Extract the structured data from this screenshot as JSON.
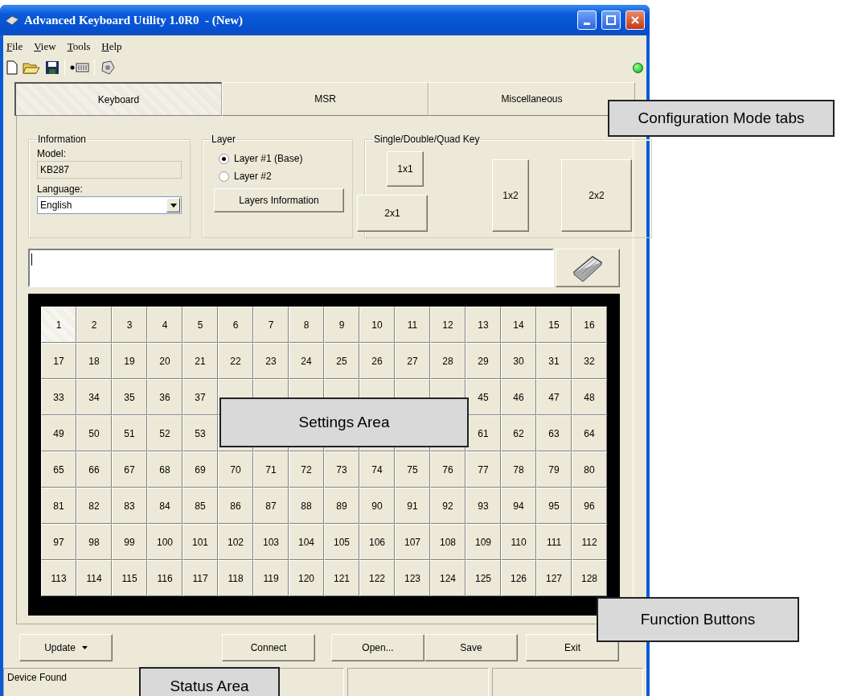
{
  "window": {
    "title": "Advanced Keyboard Utility 1.0R0  - (New)"
  },
  "menu": [
    {
      "label": "File"
    },
    {
      "label": "View"
    },
    {
      "label": "Tools"
    },
    {
      "label": "Help"
    }
  ],
  "device_indicator": {
    "on": true
  },
  "tabs": [
    {
      "label": "Keyboard",
      "selected": true
    },
    {
      "label": "MSR",
      "selected": false
    },
    {
      "label": "Miscellaneous",
      "selected": false
    }
  ],
  "information": {
    "title": "Information",
    "model_label": "Model:",
    "model_value": "KB287",
    "language_label": "Language:",
    "language_value": "English"
  },
  "layer": {
    "title": "Layer",
    "options": [
      {
        "label": "Layer #1 (Base)",
        "selected": true
      },
      {
        "label": "Layer #2",
        "selected": false
      }
    ],
    "button": "Layers Information"
  },
  "key_size": {
    "title": "Single/Double/Quad Key",
    "buttons": [
      {
        "label": "1x1",
        "kind": "single"
      },
      {
        "label": "2x1",
        "kind": "wide"
      },
      {
        "label": "1x2",
        "kind": "tall"
      },
      {
        "label": "2x2",
        "kind": "quad"
      }
    ]
  },
  "key_grid": {
    "rows": [
      [
        {
          "label": "1",
          "selected": true
        },
        {
          "label": "2",
          "selected": false
        },
        {
          "label": "3",
          "selected": false
        },
        {
          "label": "4",
          "selected": false
        },
        {
          "label": "5",
          "selected": false
        },
        {
          "label": "6",
          "selected": false
        },
        {
          "label": "7",
          "selected": false
        },
        {
          "label": "8",
          "selected": false
        },
        {
          "label": "9",
          "selected": false
        },
        {
          "label": "10",
          "selected": false
        },
        {
          "label": "11",
          "selected": false
        },
        {
          "label": "12",
          "selected": false
        },
        {
          "label": "13",
          "selected": false
        },
        {
          "label": "14",
          "selected": false
        },
        {
          "label": "15",
          "selected": false
        },
        {
          "label": "16",
          "selected": false
        }
      ],
      [
        {
          "label": "17",
          "selected": false
        },
        {
          "label": "18",
          "selected": false
        },
        {
          "label": "19",
          "selected": false
        },
        {
          "label": "20",
          "selected": false
        },
        {
          "label": "21",
          "selected": false
        },
        {
          "label": "22",
          "selected": false
        },
        {
          "label": "23",
          "selected": false
        },
        {
          "label": "24",
          "selected": false
        },
        {
          "label": "25",
          "selected": false
        },
        {
          "label": "26",
          "selected": false
        },
        {
          "label": "27",
          "selected": false
        },
        {
          "label": "28",
          "selected": false
        },
        {
          "label": "29",
          "selected": false
        },
        {
          "label": "30",
          "selected": false
        },
        {
          "label": "31",
          "selected": false
        },
        {
          "label": "32",
          "selected": false
        }
      ],
      [
        {
          "label": "33",
          "selected": false
        },
        {
          "label": "34",
          "selected": false
        },
        {
          "label": "35",
          "selected": false
        },
        {
          "label": "36",
          "selected": false
        },
        {
          "label": "37",
          "selected": false
        },
        {
          "selected": false
        },
        {
          "selected": false
        },
        {
          "selected": false
        },
        {
          "selected": false
        },
        {
          "selected": false
        },
        {
          "selected": false
        },
        {
          "selected": false
        },
        {
          "label": "45",
          "selected": false
        },
        {
          "label": "46",
          "selected": false
        },
        {
          "label": "47",
          "selected": false
        },
        {
          "label": "48",
          "selected": false
        }
      ],
      [
        {
          "label": "49",
          "selected": false
        },
        {
          "label": "50",
          "selected": false
        },
        {
          "label": "51",
          "selected": false
        },
        {
          "label": "52",
          "selected": false
        },
        {
          "label": "53",
          "selected": false
        },
        {
          "selected": false
        },
        {
          "selected": false
        },
        {
          "selected": false
        },
        {
          "selected": false
        },
        {
          "selected": false
        },
        {
          "selected": false
        },
        {
          "selected": false
        },
        {
          "label": "61",
          "selected": false
        },
        {
          "label": "62",
          "selected": false
        },
        {
          "label": "63",
          "selected": false
        },
        {
          "label": "64",
          "selected": false
        }
      ],
      [
        {
          "label": "65",
          "selected": false
        },
        {
          "label": "66",
          "selected": false
        },
        {
          "label": "67",
          "selected": false
        },
        {
          "label": "68",
          "selected": false
        },
        {
          "label": "69",
          "selected": false
        },
        {
          "label": "70",
          "selected": false
        },
        {
          "label": "71",
          "selected": false
        },
        {
          "label": "72",
          "selected": false
        },
        {
          "label": "73",
          "selected": false
        },
        {
          "label": "74",
          "selected": false
        },
        {
          "label": "75",
          "selected": false
        },
        {
          "label": "76",
          "selected": false
        },
        {
          "label": "77",
          "selected": false
        },
        {
          "label": "78",
          "selected": false
        },
        {
          "label": "79",
          "selected": false
        },
        {
          "label": "80",
          "selected": false
        }
      ],
      [
        {
          "label": "81",
          "selected": false
        },
        {
          "label": "82",
          "selected": false
        },
        {
          "label": "83",
          "selected": false
        },
        {
          "label": "84",
          "selected": false
        },
        {
          "label": "85",
          "selected": false
        },
        {
          "label": "86",
          "selected": false
        },
        {
          "label": "87",
          "selected": false
        },
        {
          "label": "88",
          "selected": false
        },
        {
          "label": "89",
          "selected": false
        },
        {
          "label": "90",
          "selected": false
        },
        {
          "label": "91",
          "selected": false
        },
        {
          "label": "92",
          "selected": false
        },
        {
          "label": "93",
          "selected": false
        },
        {
          "label": "94",
          "selected": false
        },
        {
          "label": "95",
          "selected": false
        },
        {
          "label": "96",
          "selected": false
        }
      ],
      [
        {
          "label": "97",
          "selected": false
        },
        {
          "label": "98",
          "selected": false
        },
        {
          "label": "99",
          "selected": false
        },
        {
          "label": "100",
          "selected": false
        },
        {
          "label": "101",
          "selected": false
        },
        {
          "label": "102",
          "selected": false
        },
        {
          "label": "103",
          "selected": false
        },
        {
          "label": "104",
          "selected": false
        },
        {
          "label": "105",
          "selected": false
        },
        {
          "label": "106",
          "selected": false
        },
        {
          "label": "107",
          "selected": false
        },
        {
          "label": "108",
          "selected": false
        },
        {
          "label": "109",
          "selected": false
        },
        {
          "label": "110",
          "selected": false
        },
        {
          "label": "111",
          "selected": false
        },
        {
          "label": "112",
          "selected": false
        }
      ],
      [
        {
          "label": "113",
          "selected": false
        },
        {
          "label": "114",
          "selected": false
        },
        {
          "label": "115",
          "selected": false
        },
        {
          "label": "116",
          "selected": false
        },
        {
          "label": "117",
          "selected": false
        },
        {
          "label": "118",
          "selected": false
        },
        {
          "label": "119",
          "selected": false
        },
        {
          "label": "120",
          "selected": false
        },
        {
          "label": "121",
          "selected": false
        },
        {
          "label": "122",
          "selected": false
        },
        {
          "label": "123",
          "selected": false
        },
        {
          "label": "124",
          "selected": false
        },
        {
          "label": "125",
          "selected": false
        },
        {
          "label": "126",
          "selected": false
        },
        {
          "label": "127",
          "selected": false
        },
        {
          "label": "128",
          "selected": false
        }
      ]
    ]
  },
  "function_buttons": [
    {
      "label": "Update",
      "kind": "dropdown"
    },
    {
      "label": "Connect",
      "kind": "push"
    },
    {
      "label": "Open...",
      "kind": "push"
    },
    {
      "label": "Save",
      "kind": "push"
    },
    {
      "label": "Exit",
      "kind": "push"
    }
  ],
  "status_bar": {
    "text": "Device Found"
  },
  "callouts": [
    {
      "text": "Configuration Mode tabs"
    },
    {
      "text": "Settings Area"
    },
    {
      "text": "Function Buttons"
    },
    {
      "text": "Status Area"
    }
  ]
}
